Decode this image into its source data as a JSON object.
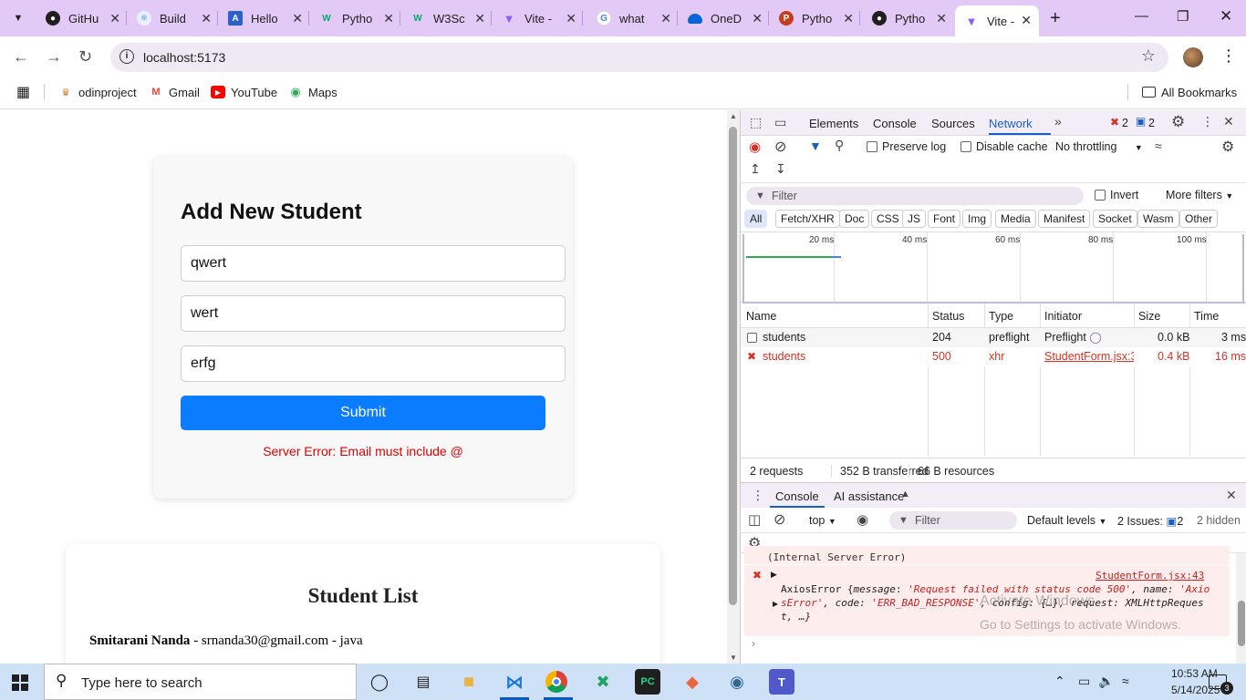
{
  "browser": {
    "tabs": [
      {
        "title": "GitHu",
        "favicon": "github-icon",
        "color": "#1f1f1f"
      },
      {
        "title": "Build",
        "favicon": "react-icon",
        "color": "#3a6fd8"
      },
      {
        "title": "Hello",
        "favicon": "azure-icon",
        "color": "#2a62c9"
      },
      {
        "title": "Pytho",
        "favicon": "w3schools-icon",
        "color": "#04aa6d"
      },
      {
        "title": "W3Sc",
        "favicon": "w3schools-icon",
        "color": "#04aa6d"
      },
      {
        "title": "Vite -",
        "favicon": "vite-icon",
        "color": "#8b5cf6"
      },
      {
        "title": "what",
        "favicon": "google-icon",
        "color": "#4285f4"
      },
      {
        "title": "OneD",
        "favicon": "onedrive-icon",
        "color": "#0a64d8"
      },
      {
        "title": "Pytho",
        "favicon": "powerpoint-icon",
        "color": "#c43e1c"
      },
      {
        "title": "Pytho",
        "favicon": "github-icon",
        "color": "#1f1f1f"
      },
      {
        "title": "Vite -",
        "favicon": "vite-icon",
        "color": "#8b5cf6"
      }
    ],
    "address": "localhost:5173",
    "bookmarks": [
      "odinproject",
      "Gmail",
      "YouTube",
      "Maps"
    ],
    "all_bookmarks": "All Bookmarks"
  },
  "page": {
    "form_title": "Add New Student",
    "inputs": [
      "qwert",
      "wert",
      "erfg"
    ],
    "submit_label": "Submit",
    "error": "Server Error: Email must include @",
    "list_title": "Student List",
    "list_items": [
      {
        "name": "Smitarani Nanda",
        "rest": " - srnanda30@gmail.com - java"
      }
    ]
  },
  "devtools": {
    "tabs": [
      "Elements",
      "Console",
      "Sources",
      "Network"
    ],
    "active_tab": "Network",
    "errors_count": "2",
    "messages_count": "2",
    "preserve_log": "Preserve log",
    "disable_cache": "Disable cache",
    "throttling": "No throttling",
    "filter_placeholder": "Filter",
    "invert": "Invert",
    "more_filters": "More filters",
    "type_filters": [
      "All",
      "Fetch/XHR",
      "Doc",
      "CSS",
      "JS",
      "Font",
      "Img",
      "Media",
      "Manifest",
      "Socket",
      "Wasm",
      "Other"
    ],
    "timeline_labels": [
      "20 ms",
      "40 ms",
      "60 ms",
      "80 ms",
      "100 ms"
    ],
    "columns": [
      "Name",
      "Status",
      "Type",
      "Initiator",
      "Size",
      "Time"
    ],
    "requests": [
      {
        "name": "students",
        "status": "204",
        "type": "preflight",
        "initiator": "Preflight",
        "size": "0.0 kB",
        "time": "3 ms"
      },
      {
        "name": "students",
        "status": "500",
        "type": "xhr",
        "initiator": "StudentForm.jsx:34",
        "size": "0.4 kB",
        "time": "16 ms"
      }
    ],
    "summary": {
      "requests": "2 requests",
      "transferred": "352 B transferred",
      "resources": "66 B resources"
    },
    "drawer_tabs": [
      "Console",
      "AI assistance"
    ],
    "context": "top",
    "console_filter": "Filter",
    "levels": "Default levels",
    "issues_label": "2 Issues:",
    "issues_count": "2",
    "hidden": "2 hidden",
    "console": {
      "prev_line": "(Internal Server Error)",
      "source": "StudentForm.jsx:43",
      "line1_prefix": "AxiosError {",
      "line1_key1": "message",
      "line1_val1": "'Request failed with status code 500'",
      "line1_key2": ", name: ",
      "line1_val2": "'Axio",
      "line2_val2": "sError'",
      "line2_rest1": ", code: ",
      "line2_code": "'ERR_BAD_RESPONSE'",
      "line2_rest2": ", config: {…}, request: XMLHttpReques",
      "line3": "t, …}"
    },
    "watermark_title": "Activate Windows",
    "watermark_sub": "Go to Settings to activate Windows."
  },
  "taskbar": {
    "search_placeholder": "Type here to search",
    "time": "10:53 AM",
    "date": "5/14/2025",
    "notifications": "3"
  }
}
